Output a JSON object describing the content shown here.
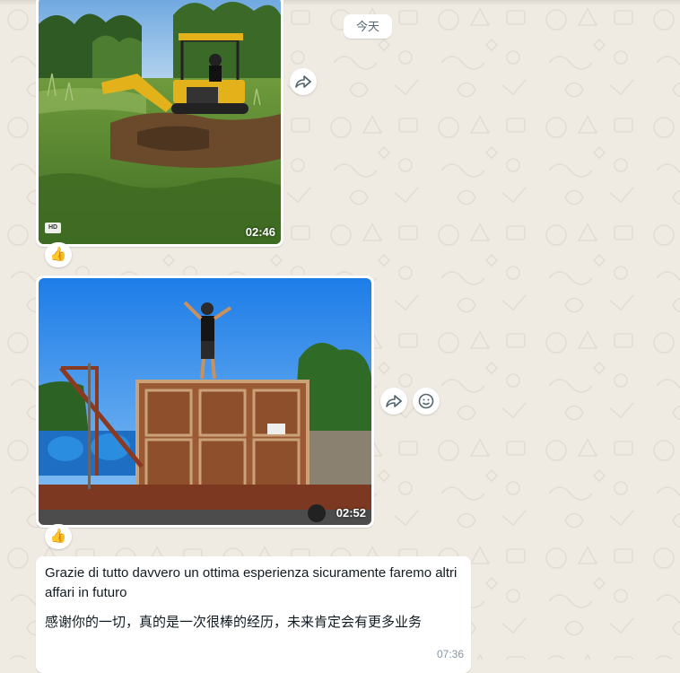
{
  "chat": {
    "date_separator": "今天",
    "messages": [
      {
        "type": "video",
        "duration": "02:46",
        "badge": "HD",
        "reaction": "👍"
      },
      {
        "type": "video",
        "duration": "02:52",
        "reaction": "👍"
      },
      {
        "type": "text",
        "text_italian": "Grazie di tutto davvero un ottima esperienza sicuramente faremo altri affari in futuro",
        "text_chinese": "感谢你的一切，真的是一次很棒的经历，未来肯定会有更多业务",
        "time": "07:36"
      }
    ]
  },
  "icons": {
    "forward": "forward-icon",
    "emoji": "emoji-icon"
  },
  "colors": {
    "background": "#efeae2",
    "bubble": "#ffffff",
    "meta_text": "#8696a0",
    "primary_text": "#111b21"
  }
}
